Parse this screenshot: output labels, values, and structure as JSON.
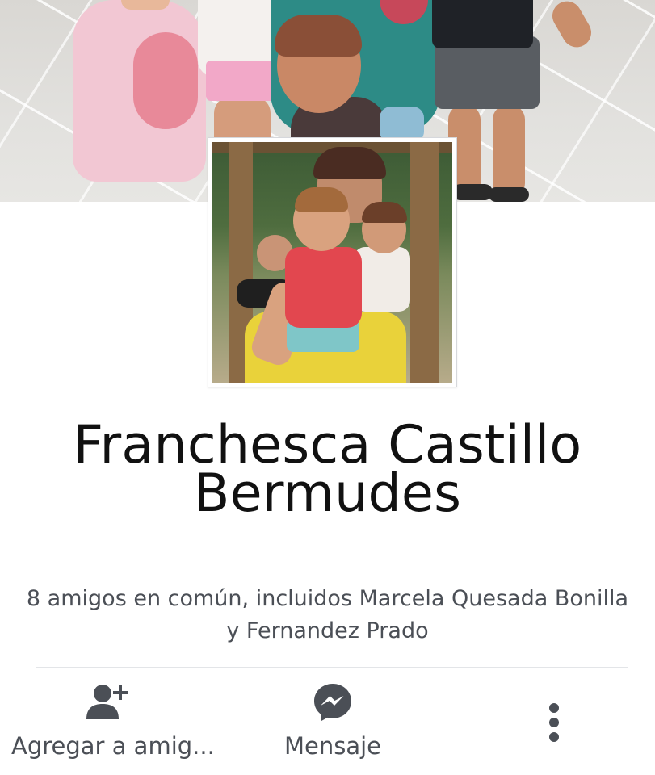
{
  "profile": {
    "name": "Franchesca Castillo Bermudes",
    "mutual_friends": "8 amigos en común, incluidos Marcela Quesada Bonilla y Fernandez Prado"
  },
  "actions": {
    "add_friend_label": "Agregar a amig...",
    "message_label": "Mensaje"
  },
  "icons": {
    "add_friend": "add-friend-icon",
    "message": "messenger-icon",
    "more": "more-vertical-icon"
  },
  "colors": {
    "icon_gray": "#4b4f56",
    "text_dark": "#111111",
    "divider": "#e3e5e8"
  }
}
